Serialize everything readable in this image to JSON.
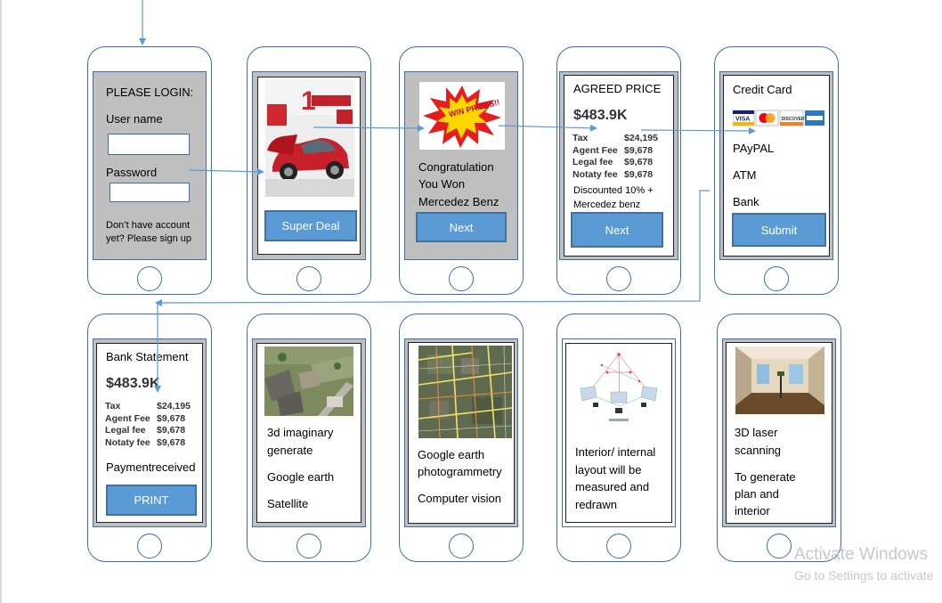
{
  "screens": {
    "login": {
      "title": "PLEASE LOGIN:",
      "username_label": "User name",
      "password_label": "Password",
      "signup_line1": "Don’t have account",
      "signup_line2": "yet? Please sign up"
    },
    "deal": {
      "button": "Super Deal"
    },
    "win": {
      "line1": "Congratulation",
      "line2": "You Won",
      "line3": "Mercedez Benz",
      "button": "Next",
      "badge": "WIN PRIZES!!"
    },
    "agreed": {
      "title": "AGREED PRICE",
      "price": "$483.9K",
      "fees": [
        [
          "Tax",
          "$24,195"
        ],
        [
          "Agent Fee",
          "$9,678"
        ],
        [
          "Legal fee",
          "$9,678"
        ],
        [
          "Notaty fee",
          "$9,678"
        ]
      ],
      "discount_line1": "Discounted 10% +",
      "discount_line2": "Mercedez benz",
      "button": "Next"
    },
    "payment": {
      "title": "Credit Card",
      "cards": [
        "VISA",
        "MC",
        "DISCOVER",
        "AMEX"
      ],
      "options": [
        "PAyPAL",
        "ATM",
        "Bank"
      ],
      "button": "Submit"
    },
    "statement": {
      "title": "Bank Statement",
      "price": "$483.9K",
      "fees": [
        [
          "Tax",
          "$24,195"
        ],
        [
          "Agent Fee",
          "$9,678"
        ],
        [
          "Legal fee",
          "$9,678"
        ],
        [
          "Notaty fee",
          "$9,678"
        ]
      ],
      "received": "Paymentreceived",
      "button": "PRINT"
    },
    "satellite": {
      "line1": "3d imaginary",
      "line2": "generate",
      "line3": "Google earth",
      "line4": "Satellite"
    },
    "photogrammetry": {
      "line1": "Google earth",
      "line2": "photogrammetry",
      "line3": "Computer vision"
    },
    "interior": {
      "line1": "Interior/ internal",
      "line2": "layout will be",
      "line3": "measured and",
      "line4": "redrawn"
    },
    "laser": {
      "line1": "3D laser",
      "line2": "scanning",
      "line3": "To generate",
      "line4": "plan and",
      "line5": "interior"
    }
  },
  "watermark": {
    "line1": "Activate Windows",
    "line2": "Go to Settings to activate"
  },
  "colors": {
    "accent": "#5b9bd5",
    "phone_border": "#3c6fa6",
    "screen_bg": "#bfbfbf"
  }
}
